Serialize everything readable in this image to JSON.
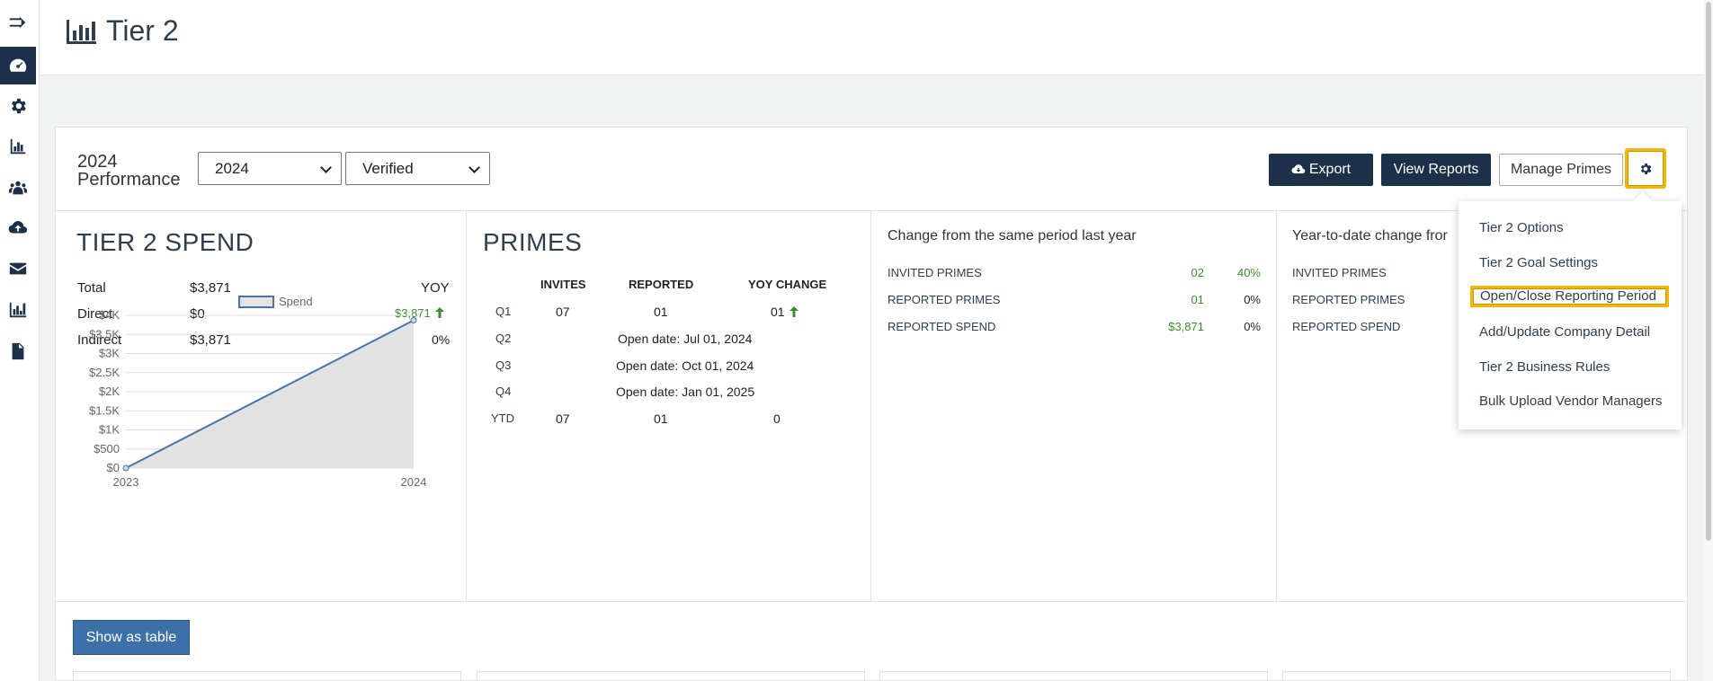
{
  "page": {
    "title": "Tier 2"
  },
  "sidebar": {
    "items": [
      {
        "icon": "arrow-right-to-line-icon"
      },
      {
        "icon": "dashboard-gauge-icon",
        "active": true
      },
      {
        "icon": "gear-icon"
      },
      {
        "icon": "bar-chart-icon"
      },
      {
        "icon": "users-cog-icon"
      },
      {
        "icon": "cloud-upload-icon"
      },
      {
        "icon": "envelope-icon"
      },
      {
        "icon": "report-chart-icon"
      },
      {
        "icon": "document-icon"
      }
    ]
  },
  "toolbar": {
    "performance_label_line1": "2024",
    "performance_label_line2": "Performance",
    "year_select": "2024",
    "status_select": "Verified",
    "export_label": "Export",
    "view_reports_label": "View Reports",
    "manage_primes_label": "Manage Primes"
  },
  "tier2_spend": {
    "title": "TIER 2 SPEND",
    "rows": [
      {
        "label": "Total",
        "value": "$3,871",
        "yoy": "YOY"
      },
      {
        "label": "Direct",
        "value": "$0",
        "yoy": "$3,871"
      },
      {
        "label": "Indirect",
        "value": "$3,871",
        "yoy": "0%"
      }
    ]
  },
  "chart_data": {
    "type": "area",
    "legend": [
      "Spend"
    ],
    "categories": [
      "2023",
      "2024"
    ],
    "series": [
      {
        "name": "Spend",
        "values": [
          0,
          3871
        ]
      }
    ],
    "y_ticks": [
      "$4K",
      "$3.5K",
      "$3K",
      "$2.5K",
      "$2K",
      "$1.5K",
      "$1K",
      "$500",
      "$0"
    ],
    "ylim": [
      0,
      4000
    ],
    "grid": true,
    "legend_position": "top-center",
    "color": "#4a74a8"
  },
  "primes": {
    "title": "PRIMES",
    "headers": [
      "INVITES",
      "REPORTED",
      "YOY CHANGE"
    ],
    "rows": [
      {
        "q": "Q1",
        "invites": "07",
        "reported": "01",
        "yoy": "01"
      },
      {
        "q": "Q2",
        "open": "Open date: Jul 01, 2024"
      },
      {
        "q": "Q3",
        "open": "Open date: Oct 01, 2024"
      },
      {
        "q": "Q4",
        "open": "Open date: Jan 01, 2025"
      },
      {
        "q": "YTD",
        "invites": "07",
        "reported": "01",
        "yoy": "0"
      }
    ]
  },
  "change_same_period": {
    "title": "Change from the same period last year",
    "rows": [
      {
        "label": "INVITED PRIMES",
        "value": "02",
        "pct": "40%"
      },
      {
        "label": "REPORTED PRIMES",
        "value": "01",
        "pct": "0%"
      },
      {
        "label": "REPORTED SPEND",
        "value": "$3,871",
        "pct": "0%"
      }
    ]
  },
  "ytd_change": {
    "title": "Year-to-date change fror",
    "rows": [
      {
        "label": "INVITED PRIMES"
      },
      {
        "label": "REPORTED PRIMES"
      },
      {
        "label": "REPORTED SPEND"
      }
    ]
  },
  "show_table_label": "Show as table",
  "settings_menu": {
    "items": [
      "Tier 2 Options",
      "Tier 2 Goal Settings",
      "Open/Close Reporting Period",
      "Add/Update Company Detail",
      "Tier 2 Business Rules",
      "Bulk Upload Vendor Managers"
    ]
  },
  "colors": {
    "navy": "#1c3149",
    "highlight": "#f2b705",
    "positive": "#3d8c2d",
    "primary_button": "#3d6fa8"
  }
}
